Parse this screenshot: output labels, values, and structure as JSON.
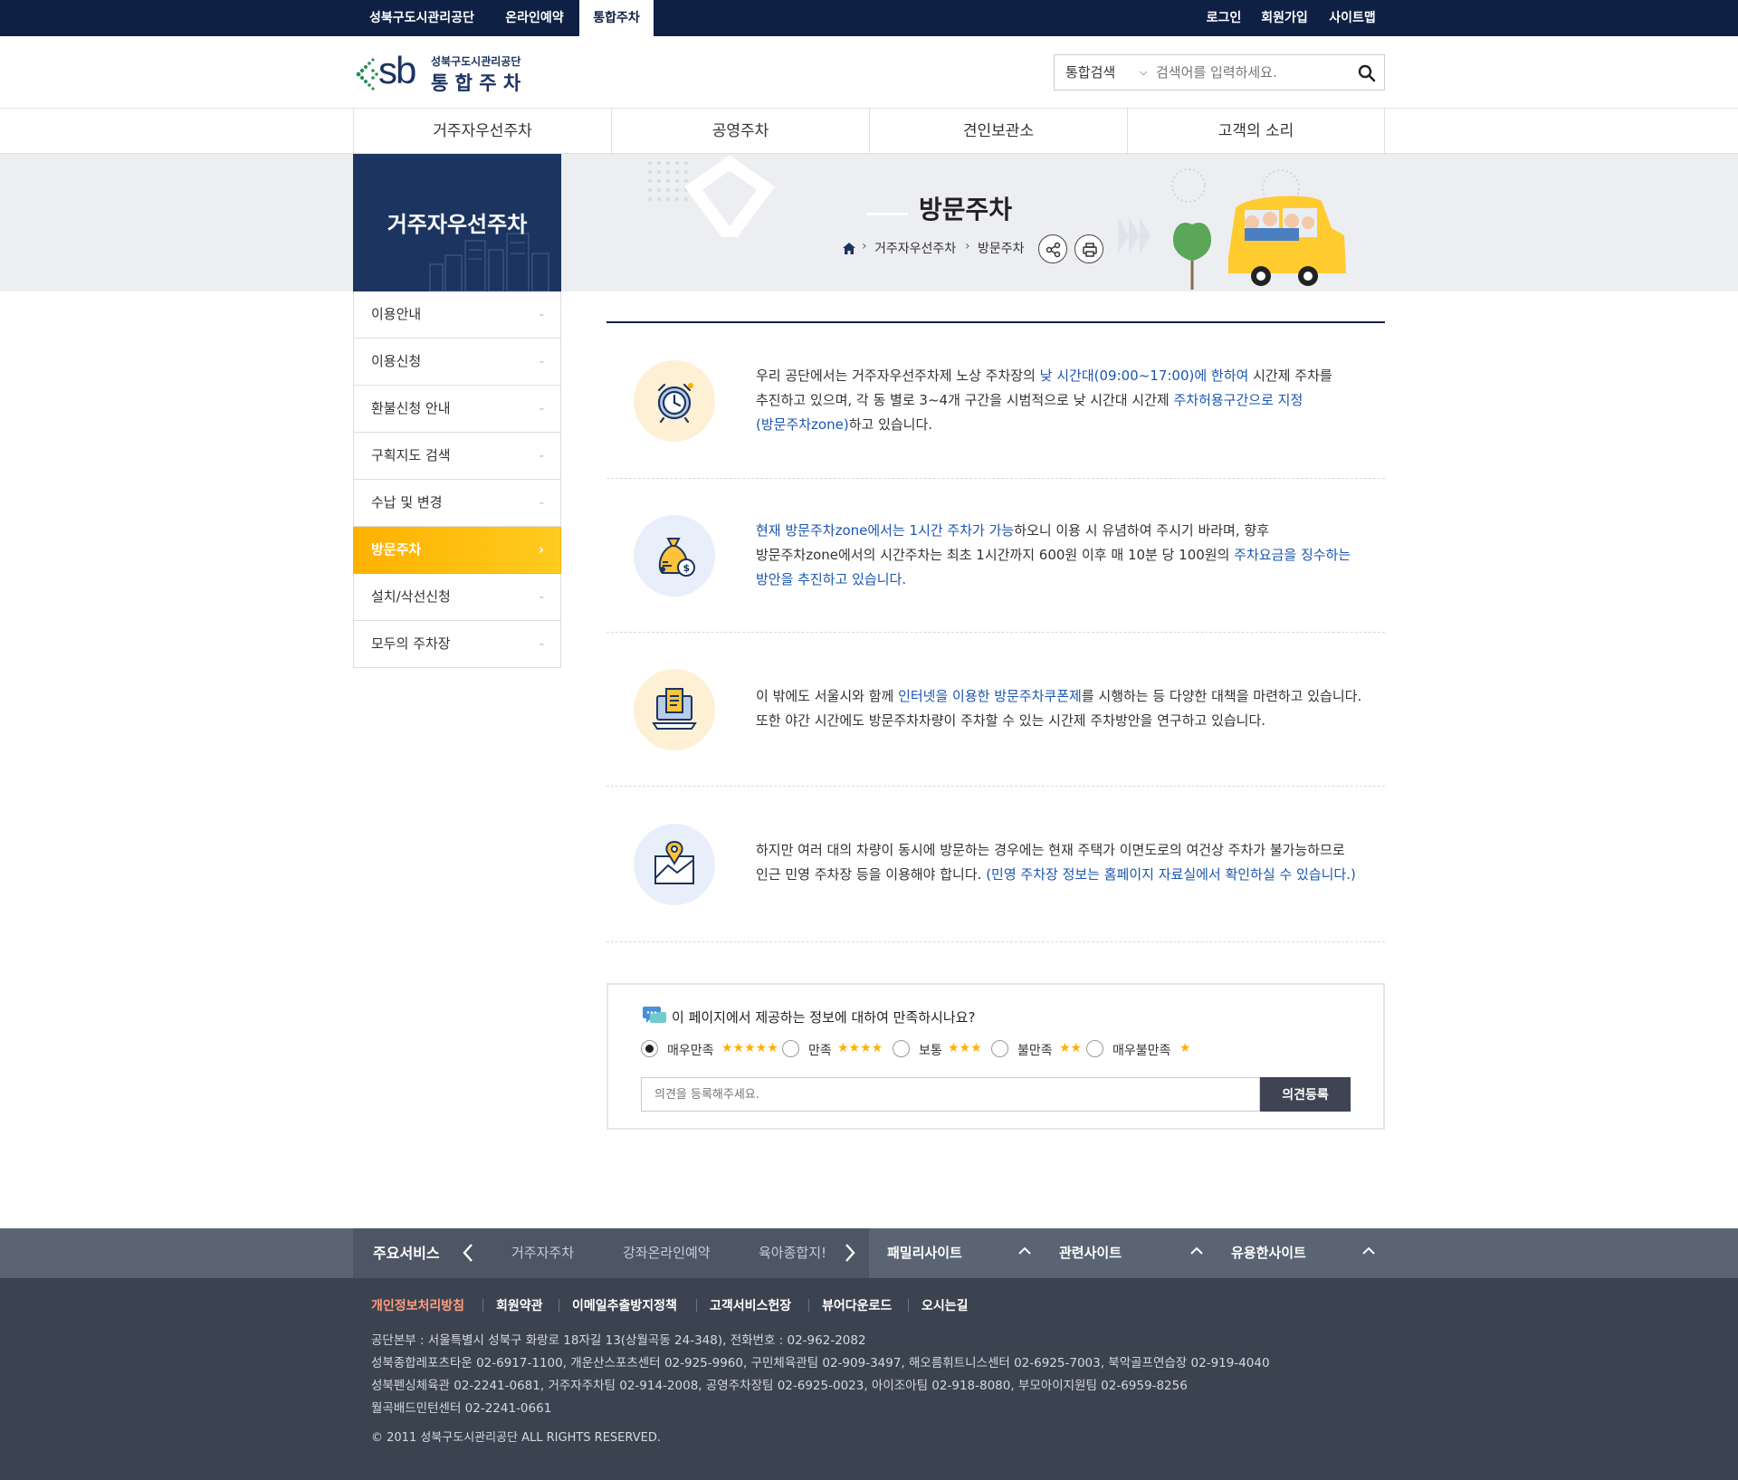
{
  "topbar": {
    "items": [
      "성북구도시관리공단",
      "온라인예약",
      "통합주차"
    ],
    "right": [
      "로그인",
      "회원가입",
      "사이트맵"
    ]
  },
  "header": {
    "logo_text": "sb",
    "logo_sub": "성북구도시관리공단",
    "logo_main": "통 합 주 차",
    "search_select": "통합검색",
    "search_placeholder": "검색어를 입력하세요."
  },
  "gnb": [
    "거주자우선주차",
    "공영주차",
    "견인보관소",
    "고객의 소리"
  ],
  "visual": {
    "side_title": "거주자우선주차",
    "page_title": "방문주차",
    "breadcrumb": [
      "거주자우선주차",
      "방문주차"
    ]
  },
  "lnb": [
    "이용안내",
    "이용신청",
    "환불신청 안내",
    "구획지도 검색",
    "수납 및 변경",
    "방문주차",
    "설치/삭선신청",
    "모두의 주차장"
  ],
  "lnb_active": "방문주차",
  "sections": [
    {
      "icon": "alarm-clock-icon",
      "lines": [
        [
          [
            "우리 공단에서는 거주자우선주차제 노상 주차장의 ",
            0
          ],
          [
            "낮 시간대(09:00~17:00)에 한하여",
            1
          ],
          [
            " 시간제 주차를",
            0
          ]
        ],
        [
          [
            "추진하고 있으며, 각 동 별로 3~4개 구간을 시범적으로 낮 시간대 시간제 ",
            0
          ],
          [
            "주차허용구간으로 지정",
            1
          ]
        ],
        [
          [
            "(방문주차zone)",
            1
          ],
          [
            "하고 있습니다.",
            0
          ]
        ]
      ]
    },
    {
      "icon": "money-bag-icon",
      "lines": [
        [
          [
            "현재 방문주차zone에서는 1시간 주차가 가능",
            1
          ],
          [
            "하오니 이용 시 유념하여 주시기 바라며, 향후",
            0
          ]
        ],
        [
          [
            "방문주차zone에서의 시간주차는 최초 1시간까지 600원 이후 매 10분 당 100원의 ",
            0
          ],
          [
            "주차요금을 징수하는",
            1
          ]
        ],
        [
          [
            "방안을 추진하고 있습니다.",
            1
          ]
        ]
      ]
    },
    {
      "icon": "laptop-document-icon",
      "lines": [
        [
          [
            "이 밖에도 서울시와 함께 ",
            0
          ],
          [
            "인터넷을 이용한 방문주차쿠폰제",
            1
          ],
          [
            "를 시행하는 등 다양한 대책을 마련하고 있습니다.",
            0
          ]
        ],
        [
          [
            "또한 야간 시간에도 방문주차차량이 주차할 수 있는 시간제 주차방안을 연구하고 있습니다.",
            0
          ]
        ]
      ]
    },
    {
      "icon": "map-pin-icon",
      "lines": [
        [
          [
            "하지만 여러 대의 차량이 동시에 방문하는 경우에는 현재 주택가 이면도로의 여건상 주차가 불가능하므로",
            0
          ]
        ],
        [
          [
            "인근 민영 주차장 등을 이용해야 합니다. ",
            0
          ],
          [
            "(민영 주차장 정보는 홈페이지 자료실에서 확인하실 수 있습니다.)",
            1
          ]
        ]
      ]
    }
  ],
  "survey": {
    "question": "이 페이지에서 제공하는 정보에 대하여 만족하시나요?",
    "options": [
      {
        "label": "매우만족",
        "stars": 5,
        "checked": true
      },
      {
        "label": "만족",
        "stars": 4,
        "checked": false
      },
      {
        "label": "보통",
        "stars": 3,
        "checked": false
      },
      {
        "label": "불만족",
        "stars": 2,
        "checked": false
      },
      {
        "label": "매우불만족",
        "stars": 1,
        "checked": false
      }
    ],
    "placeholder": "의견을 등록해주세요.",
    "submit_label": "의견등록"
  },
  "footer_nav": {
    "main_label": "주요서비스",
    "items": [
      "거주자주차",
      "강좌온라인예약",
      "육아종합지!"
    ],
    "family": "패밀리사이트",
    "related": "관련사이트",
    "useful": "유용한사이트"
  },
  "footer": {
    "links": [
      "개인정보처리방침",
      "회원약관",
      "이메일추출방지정책",
      "고객서비스헌장",
      "뷰어다운로드",
      "오시는길"
    ],
    "info": [
      "공단본부 : 서울특별시 성북구 화랑로 18자길 13(상월곡동 24-348), 전화번호 : 02-962-2082",
      "성북종합레포츠타운 02-6917-1100, 개운산스포츠센터 02-925-9960, 구민체육관팀 02-909-3497, 해오름휘트니스센터 02-6925-7003, 북악골프연습장 02-919-4040",
      "성북펜싱체육관 02-2241-0681, 거주자주차팀 02-914-2008, 공영주차장팀 02-6925-0023, 아이조아팀 02-918-8080, 부모아이지원팀 02-6959-8256",
      "월곡배드민턴센터 02-2241-0661"
    ],
    "copyright": "© 2011 성북구도시관리공단 ALL RIGHTS RESERVED."
  }
}
